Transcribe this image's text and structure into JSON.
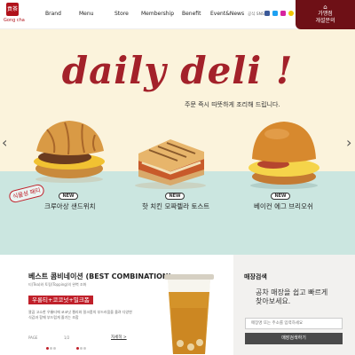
{
  "header": {
    "logo_text": "Gong cha",
    "logo_mark": "貢茶",
    "nav": [
      "Brand",
      "Menu",
      "Store",
      "Membership",
      "Benefit",
      "Event&News"
    ],
    "shortcut_label": "공식 SNS",
    "sns_icons": [
      "facebook-icon",
      "twitter-icon",
      "instagram-icon",
      "kakao-icon"
    ],
    "franchise": {
      "icon": "⌂",
      "line1": "가맹점",
      "line2": "개설문의"
    }
  },
  "hero": {
    "title": "daily deli !",
    "subtitle": "주문 즉시 따뜻하게 조리해 드립니다.",
    "prev_arrow": "‹",
    "next_arrow": "›",
    "sticker": "식물성 패티",
    "items": [
      {
        "badge": "NEW",
        "name": "크루아상 샌드위치"
      },
      {
        "badge": "NEW",
        "name": "핫 치킨 모짜렐라 토스트"
      },
      {
        "badge": "NEW",
        "name": "베이컨 에그 브리오쉬"
      }
    ],
    "colors": {
      "top": "#fbf3dc",
      "bottom": "#cbe6e0",
      "title": "#a3212a"
    }
  },
  "best": {
    "title": "베스트 콤비네이션 (BEST COMBINATION)",
    "desc": "티(Tea)와 토핑(Topping)의 완벽 조화",
    "badge": "우롱티+코코넛+밀크폼",
    "body": "깔끔 고소한 우롱티에 코코넛 젤리와 밀크폼의 부드러움을 올려 다양한 식감과 함께 부드럽게 즐기는 조합",
    "pager_label": "PAGE",
    "pager_count": "1/2",
    "more": "자세히 >"
  },
  "store": {
    "title": "매장검색",
    "line1": "공차 매장을 쉽고 빠르게",
    "line2": "찾아보세요.",
    "placeholder": "매장명 또는 주소를 입력하세요",
    "button": "매장검색하기"
  }
}
